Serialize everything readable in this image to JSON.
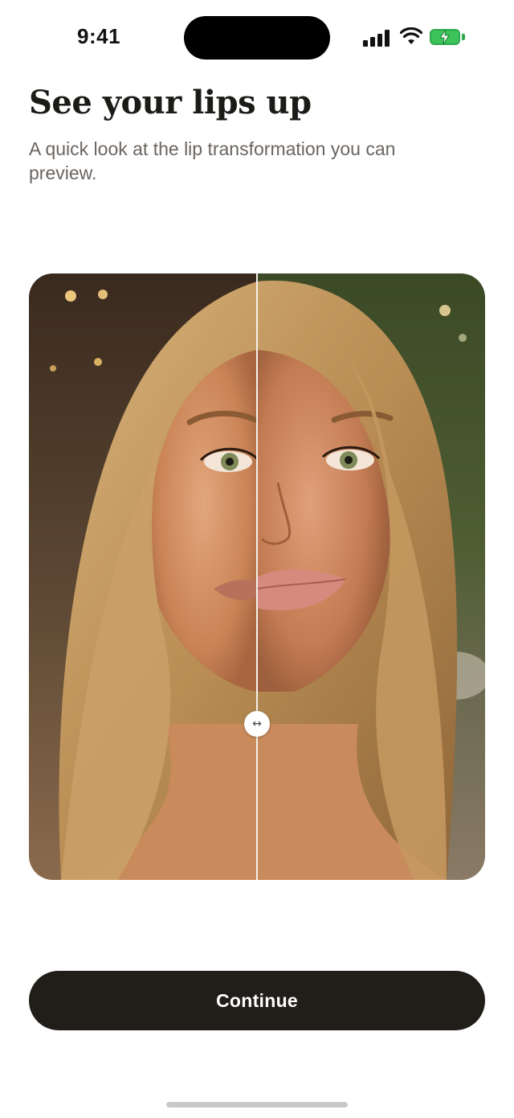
{
  "status_bar": {
    "time": "9:41",
    "icons": [
      "cellular-signal-icon",
      "wifi-icon",
      "battery-charging-icon"
    ],
    "battery_color": "#3cc35a"
  },
  "header": {
    "title": "See your lips up",
    "subtitle": "A quick look at the lip transformation you can preview."
  },
  "comparison": {
    "handle_icon": "↔"
  },
  "actions": {
    "continue_label": "Continue",
    "button_color": "#211e1a"
  }
}
